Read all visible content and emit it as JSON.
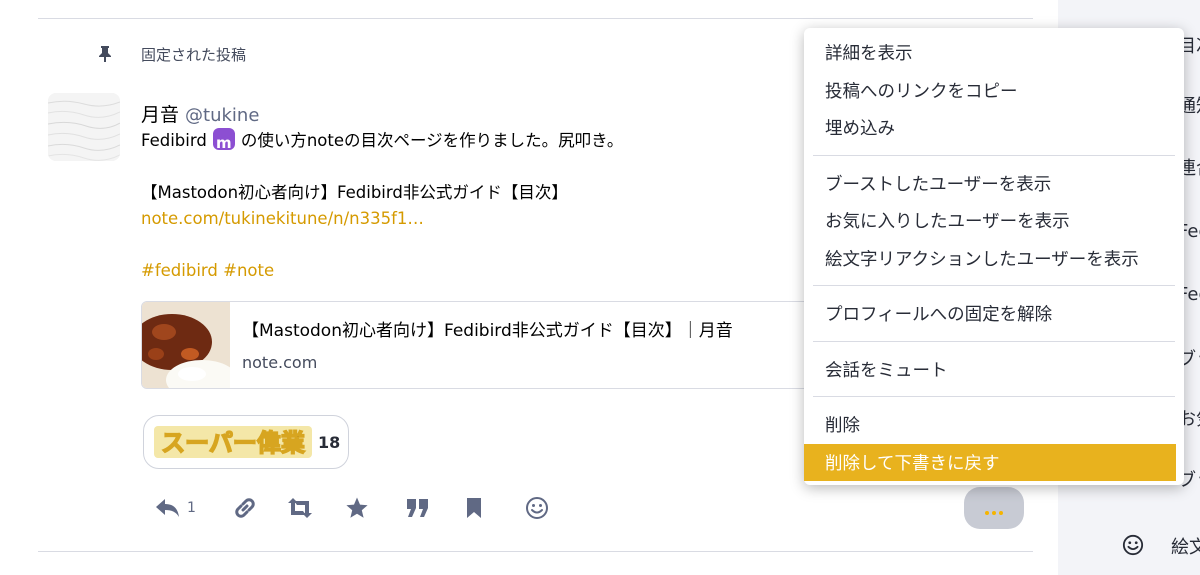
{
  "pinned": {
    "label": "固定された投稿"
  },
  "status": {
    "display_name": "月音",
    "acct": "@tukine",
    "content": {
      "line1_pre": "Fedibird",
      "emoji_letter": "m",
      "line1_post": "の使い方noteの目次ページを作りました。尻叩き。",
      "line2": "【Mastodon初心者向け】Fedibird非公式ガイド【目次】",
      "link": "note.com/tukinekitune/n/n335f1…",
      "hashtag1": "#fedibird",
      "hashtag2": "#note"
    },
    "card": {
      "title": "【Mastodon初心者向け】Fedibird非公式ガイド【目次】｜月音",
      "host": "note.com"
    },
    "reaction": {
      "image_text": "スーパー偉業",
      "count": "18"
    },
    "actions": {
      "reply_count": "1"
    }
  },
  "menu": {
    "items": [
      "詳細を表示",
      "投稿へのリンクをコピー",
      "埋め込み",
      "ブーストしたユーザーを表示",
      "お気に入りしたユーザーを表示",
      "絵文字リアクションしたユーザーを表示",
      "プロフィールへの固定を解除",
      "会話をミュート",
      "削除",
      "削除して下書きに戻す"
    ]
  },
  "sidebar": {
    "fragments": [
      "目次",
      "通知",
      "連合",
      "Fed",
      "Fed",
      "ブッ",
      "お気",
      "ブッ"
    ],
    "bottom_label": "絵文",
    "bottom_icon": "smile-icon"
  },
  "colors": {
    "accent": "#e8b21e",
    "link": "#d59a00",
    "emoji_bg": "#8c4fd2"
  }
}
